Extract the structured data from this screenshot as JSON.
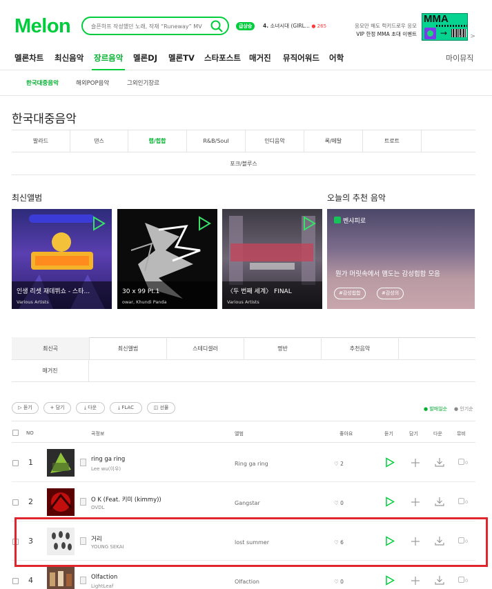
{
  "header": {
    "logo": "Melon",
    "search_placeholder": "슬픈하프 작성했던 노래, 작재 “Runeway” MV",
    "rank_badge": "급상승",
    "rank_number": "4.",
    "rank_title": "소녀시대 (GIRL...",
    "rank_change": "● 265",
    "promo_line1": "응모만 해도 럭키드로우 응모",
    "promo_line2": "VIP 한정 MMA 초대 이벤트",
    "promo_logo": "MMA",
    "promo_nav": "< >"
  },
  "gnb": {
    "items": [
      "멜론차트",
      "최신음악",
      "장르음악",
      "멜론DJ",
      "멜론TV",
      "스타포스트",
      "매거진",
      "뮤직어워드",
      "어학"
    ],
    "my": "마이뮤직"
  },
  "subnav": [
    "한국대중음악",
    "해외POP음악",
    "그외인기장르"
  ],
  "page_title": "한국대중음악",
  "genres": [
    "발라드",
    "댄스",
    "랩/힙합",
    "R&B/Soul",
    "인디음악",
    "록/메탈",
    "트로트",
    "포크/블루스"
  ],
  "new_albums": {
    "title": "최신앨범",
    "items": [
      {
        "title": "인생 리셋 재데뷔쇼 - 스타...",
        "artist": "Various Artists"
      },
      {
        "title": "30 x 99 Pt.1",
        "artist": "owar, Khundi Panda"
      },
      {
        "title": "〈두 번째 세계〉 FINAL",
        "artist": "Various Artists"
      }
    ]
  },
  "today_rec": {
    "title": "오늘의 추천 음악",
    "tag": "벤샤피로",
    "desc": "뭔가 머릿속에서 맴도는 감성힙합 모음",
    "hashtags": [
      "#감성힙합",
      "#감성의"
    ]
  },
  "list_tabs": [
    "최신곡",
    "최신앨범",
    "스테디셀러",
    "명반",
    "추천음악",
    "매거진"
  ],
  "toolbar": {
    "buttons": [
      "▷ 듣기",
      "+ 담기",
      "⤓ 다운",
      "⤓ FLAC",
      "◫ 선물"
    ],
    "sort": [
      "● 발매일순",
      "● 인기순"
    ]
  },
  "table": {
    "headers": [
      "NO",
      "곡정보",
      "앨범",
      "좋아요",
      "듣기",
      "담기",
      "다운",
      "뮤비"
    ],
    "rows": [
      {
        "rank": "1",
        "title": "ring ga ring",
        "artist": "Lee wu(이우)",
        "album": "Ring ga ring",
        "likes": "♡ 2",
        "mv": "0"
      },
      {
        "rank": "2",
        "title": "O K (Feat. 키미 (kimmy))",
        "artist": "OVDL",
        "album": "Gangstar",
        "likes": "♡ 0",
        "mv": "0"
      },
      {
        "rank": "3",
        "title": "거리",
        "artist": "YOUNG SEKAI",
        "album": "lost summer",
        "likes": "♡ 6",
        "mv": "0"
      },
      {
        "rank": "4",
        "title": "Olfaction",
        "artist": "LightLeaf",
        "album": "Olfaction",
        "likes": "♡ 0",
        "mv": "0"
      }
    ]
  },
  "colors": {
    "brand": "#00cd3c",
    "highlight": "#e0262c"
  }
}
